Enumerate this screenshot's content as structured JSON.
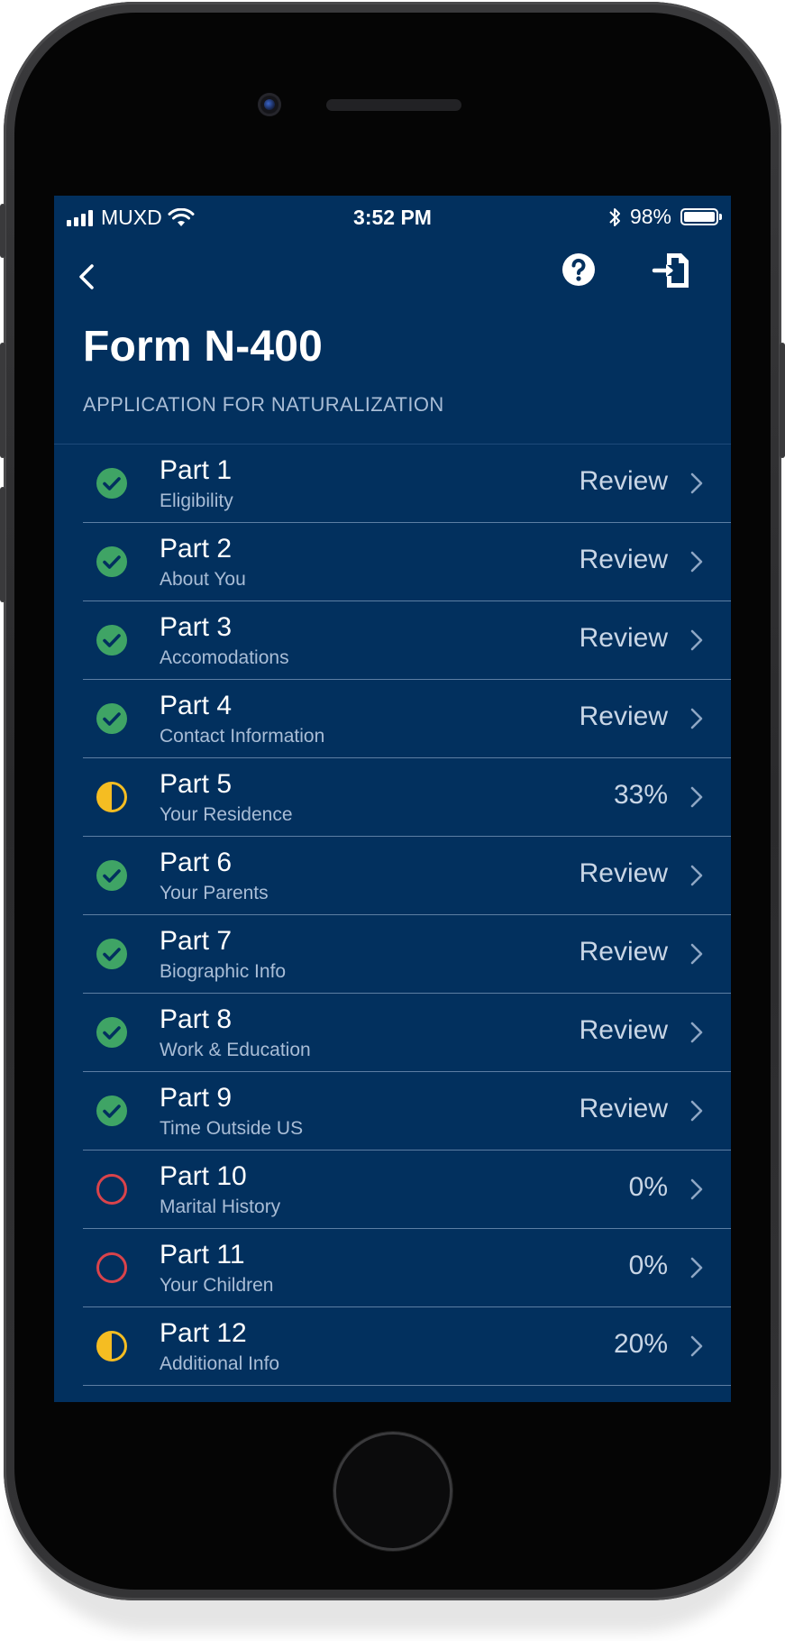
{
  "status_bar": {
    "carrier": "MUXD",
    "time": "3:52 PM",
    "battery": "98%"
  },
  "nav": {
    "back_icon": "chevron-left-icon",
    "help_icon": "question-circle-icon",
    "exit_icon": "document-exit-icon"
  },
  "header": {
    "title": "Form N-400",
    "subtitle": "APPLICATION FOR NATURALIZATION"
  },
  "colors": {
    "background": "#02305e",
    "complete": "#3fa465",
    "partial": "#f5bd22",
    "not_started": "#d9434b"
  },
  "parts": [
    {
      "title": "Part 1",
      "subtitle": "Eligibility",
      "status": "Review",
      "state": "complete"
    },
    {
      "title": "Part 2",
      "subtitle": "About You",
      "status": "Review",
      "state": "complete"
    },
    {
      "title": "Part 3",
      "subtitle": "Accomodations",
      "status": "Review",
      "state": "complete"
    },
    {
      "title": "Part 4",
      "subtitle": "Contact Information",
      "status": "Review",
      "state": "complete"
    },
    {
      "title": "Part 5",
      "subtitle": "Your Residence",
      "status": "33%",
      "state": "partial"
    },
    {
      "title": "Part 6",
      "subtitle": "Your Parents",
      "status": "Review",
      "state": "complete"
    },
    {
      "title": "Part 7",
      "subtitle": "Biographic Info",
      "status": "Review",
      "state": "complete"
    },
    {
      "title": "Part 8",
      "subtitle": "Work & Education",
      "status": "Review",
      "state": "complete"
    },
    {
      "title": "Part 9",
      "subtitle": "Time Outside US",
      "status": "Review",
      "state": "complete"
    },
    {
      "title": "Part 10",
      "subtitle": "Marital History",
      "status": "0%",
      "state": "not_started"
    },
    {
      "title": "Part 11",
      "subtitle": "Your Children",
      "status": "0%",
      "state": "not_started"
    },
    {
      "title": "Part 12",
      "subtitle": "Additional Info",
      "status": "20%",
      "state": "partial"
    }
  ]
}
